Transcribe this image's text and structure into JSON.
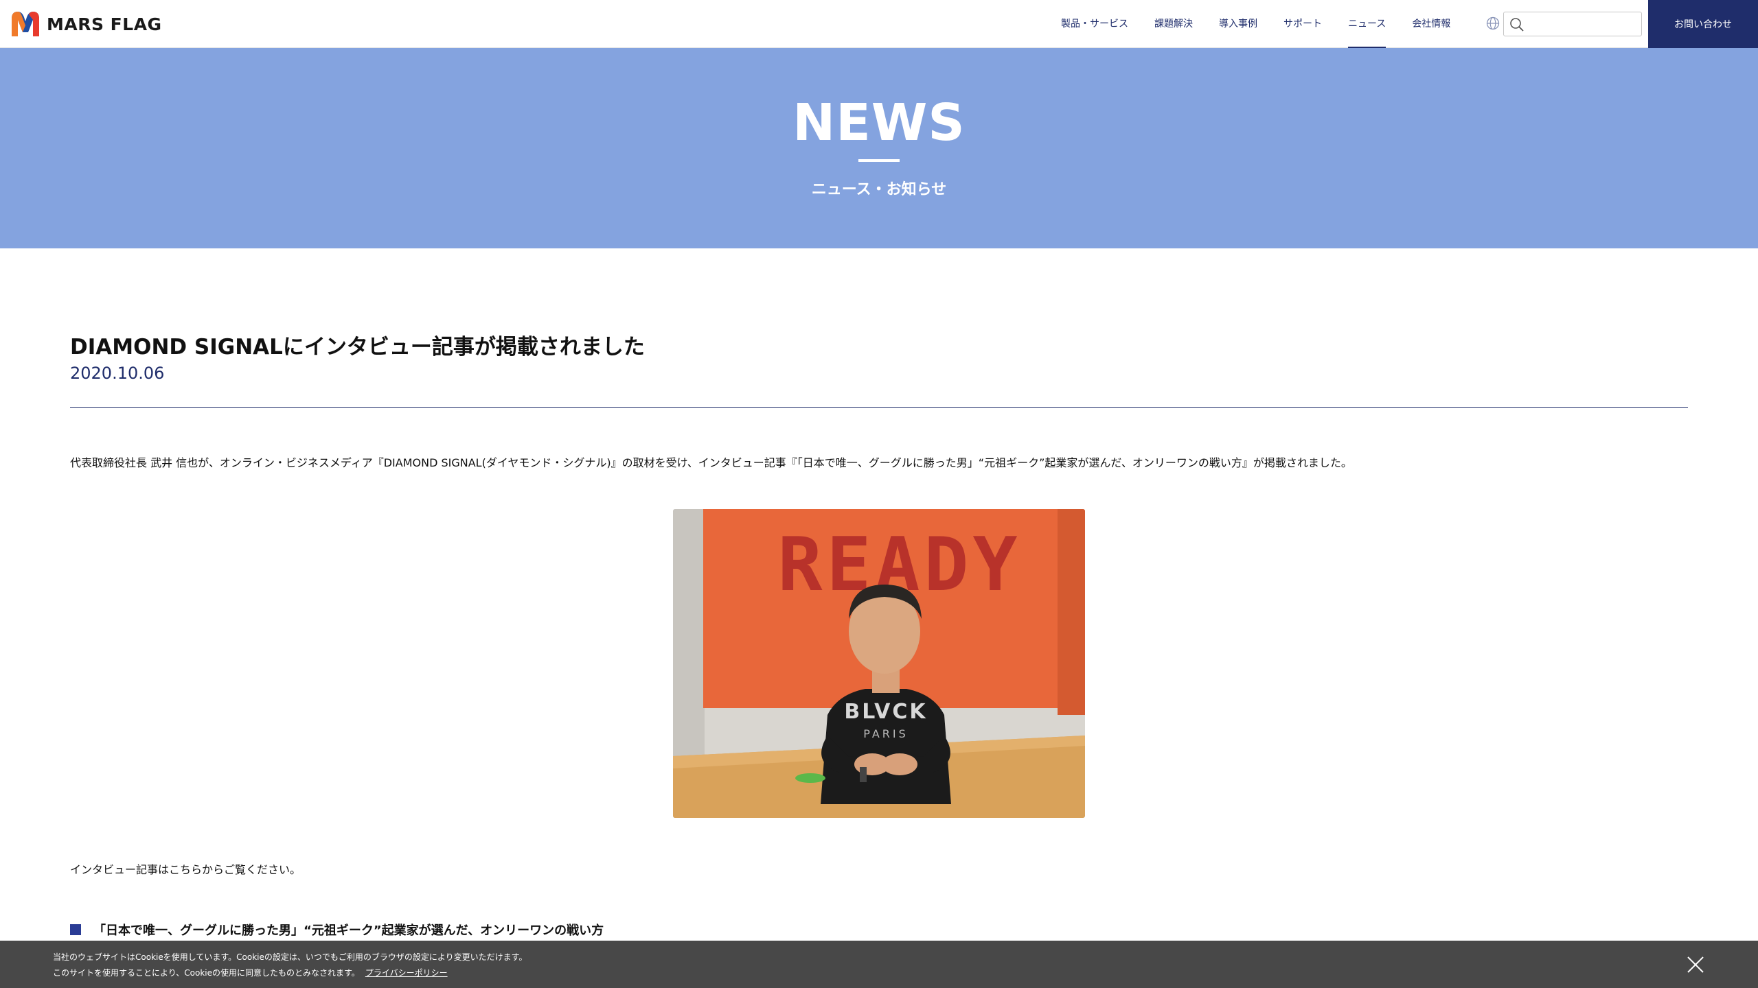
{
  "header": {
    "logo_text": "MARS FLAG",
    "nav": [
      {
        "label": "製品・サービス",
        "active": false
      },
      {
        "label": "課題解決",
        "active": false
      },
      {
        "label": "導入事例",
        "active": false
      },
      {
        "label": "サポート",
        "active": false
      },
      {
        "label": "ニュース",
        "active": true
      },
      {
        "label": "会社情報",
        "active": false
      }
    ],
    "search_placeholder": "",
    "contact_label": "お問い合わせ"
  },
  "hero": {
    "title": "NEWS",
    "subtitle": "ニュース・お知らせ"
  },
  "article": {
    "title": "DIAMOND SIGNALにインタビュー記事が掲載されました",
    "date": "2020.10.06",
    "body": "代表取締役社長 武井 信也が、オンライン・ビジネスメディア『DIAMOND SIGNAL(ダイヤモンド・シグナル)』の取材を受け、インタビュー記事『「日本で唯一、グーグルに勝った男」“元祖ギーク”起業家が選んだ、オンリーワンの戦い方』が掲載されました。",
    "photo_sign_text": "READY",
    "photo_shirt_text": "BLVCK",
    "photo_shirt_sub": "PARIS",
    "after_photo": "インタビュー記事はこちらからご覧ください。",
    "link_text": "「日本で唯一、グーグルに勝った男」“元祖ギーク”起業家が選んだ、オンリーワンの戦い方"
  },
  "cookie": {
    "line1": "当社のウェブサイトはCookieを使用しています。Cookieの設定は、いつでもご利用のブラウザの設定により変更いただけます。",
    "line2": "このサイトを使用することにより、Cookieの使用に同意したものとみなされます。",
    "privacy_link": "プライバシーポリシー"
  },
  "colors": {
    "brand_navy": "#1f2d6b",
    "hero_blue": "#84a3df",
    "cookie_bg": "#3e3e3e",
    "photo_orange": "#e8673a"
  }
}
